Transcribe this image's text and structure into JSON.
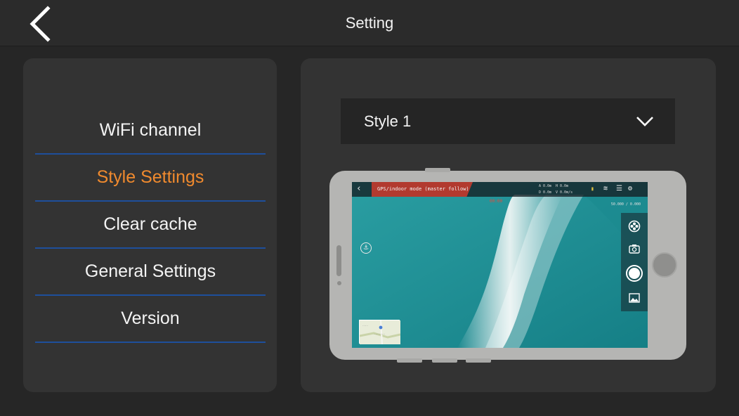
{
  "header": {
    "title": "Setting",
    "back_icon": "chevron-left-icon"
  },
  "sidebar": {
    "items": [
      {
        "label": "WiFi channel",
        "active": false
      },
      {
        "label": "Style Settings",
        "active": true
      },
      {
        "label": "Clear cache",
        "active": false
      },
      {
        "label": "General Settings",
        "active": false
      },
      {
        "label": "Version",
        "active": false
      }
    ]
  },
  "style": {
    "selected": "Style 1",
    "dropdown_icon": "chevron-down-icon"
  },
  "preview": {
    "mode_text": "GPS/indoor mode (master follow)",
    "stats": [
      "A 0.0m",
      "H 0.0m",
      "D 0.0m",
      "V 0.0m/s"
    ],
    "rec_time": "00:00",
    "coords": "50.000 / 0.000",
    "minimap_labels": [
      "……",
      "…………"
    ]
  },
  "colors": {
    "background": "#262626",
    "panel": "#333333",
    "accent_active": "#f08a2e",
    "divider": "#1e4f9c",
    "hud_mode": "#b23a2f"
  }
}
